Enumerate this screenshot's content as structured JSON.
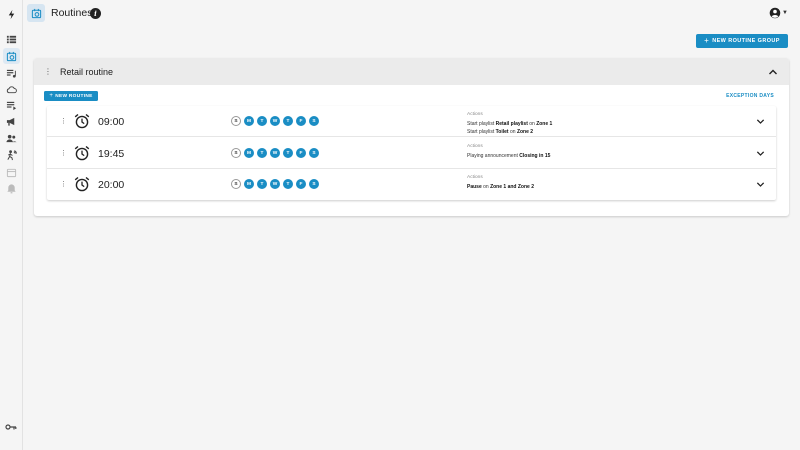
{
  "header": {
    "title": "Routines"
  },
  "sidebar": {
    "items": [
      {
        "name": "logo-icon",
        "active": false
      },
      {
        "name": "list-icon",
        "active": false
      },
      {
        "name": "routines-icon",
        "active": true
      },
      {
        "name": "playlist-icon",
        "active": false
      },
      {
        "name": "cloud-icon",
        "active": false
      },
      {
        "name": "library-icon",
        "active": false
      },
      {
        "name": "megaphone-icon",
        "active": false
      },
      {
        "name": "users-icon",
        "active": false
      },
      {
        "name": "motion-icon",
        "active": false
      },
      {
        "name": "calendar-icon",
        "active": false
      },
      {
        "name": "bell-icon",
        "active": false
      }
    ],
    "bottom_icon": "key-icon"
  },
  "toolbar": {
    "new_group_label": "NEW ROUTINE GROUP"
  },
  "group": {
    "title": "Retail routine",
    "new_routine_label": "NEW ROUTINE",
    "exception_days_label": "EXCEPTION DAYS",
    "routines": [
      {
        "time": "09:00",
        "days": [
          {
            "letter": "S",
            "on": false
          },
          {
            "letter": "M",
            "on": true
          },
          {
            "letter": "T",
            "on": true
          },
          {
            "letter": "W",
            "on": true
          },
          {
            "letter": "T",
            "on": true
          },
          {
            "letter": "F",
            "on": true
          },
          {
            "letter": "S",
            "on": true
          }
        ],
        "actions_heading": "Actions",
        "actions": [
          {
            "prefix": "Start playlist ",
            "bold1": "Retail playlist",
            "middle": " on ",
            "bold2": "Zone 1"
          },
          {
            "prefix": "Start playlist ",
            "bold1": "Toilet",
            "middle": " on ",
            "bold2": "Zone 2"
          }
        ]
      },
      {
        "time": "19:45",
        "days": [
          {
            "letter": "S",
            "on": false
          },
          {
            "letter": "M",
            "on": true
          },
          {
            "letter": "T",
            "on": true
          },
          {
            "letter": "W",
            "on": true
          },
          {
            "letter": "T",
            "on": true
          },
          {
            "letter": "F",
            "on": true
          },
          {
            "letter": "S",
            "on": true
          }
        ],
        "actions_heading": "Actions",
        "actions": [
          {
            "prefix": "Playing announcement ",
            "bold1": "Closing in 15",
            "middle": "",
            "bold2": ""
          }
        ]
      },
      {
        "time": "20:00",
        "days": [
          {
            "letter": "S",
            "on": false
          },
          {
            "letter": "M",
            "on": true
          },
          {
            "letter": "T",
            "on": true
          },
          {
            "letter": "W",
            "on": true
          },
          {
            "letter": "T",
            "on": true
          },
          {
            "letter": "F",
            "on": true
          },
          {
            "letter": "S",
            "on": true
          }
        ],
        "actions_heading": "Actions",
        "actions": [
          {
            "prefix": "",
            "bold1": "Pause",
            "middle": " on ",
            "bold2": "Zone 1 and Zone 2"
          }
        ]
      }
    ]
  },
  "colors": {
    "accent": "#1a8dc4",
    "header_bg": "#ebebeb",
    "page_bg": "#f5f5f5"
  }
}
